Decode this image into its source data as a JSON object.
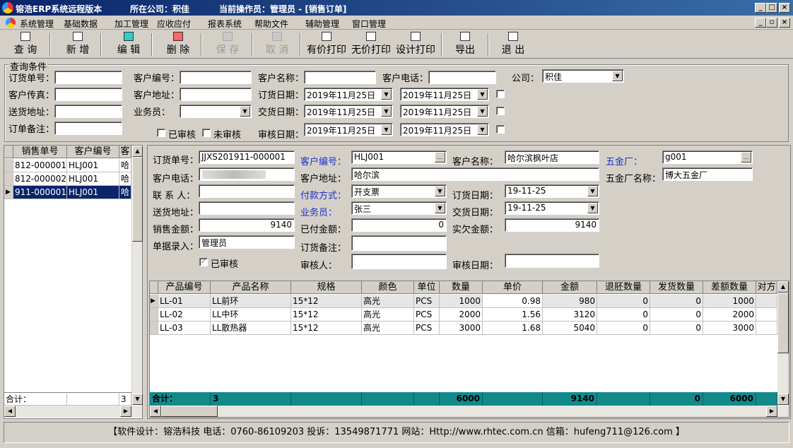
{
  "title": {
    "app": "镕浩ERP系统远程版本",
    "company_label": "所在公司：积佳",
    "operator_label": "当前操作员：管理员 - [销售订单]"
  },
  "menu": [
    "系统管理",
    "基础数据",
    "加工管理",
    "应收应付",
    "报表系统",
    "帮助文件",
    "辅助管理",
    "窗口管理"
  ],
  "toolbar": {
    "query": "查 询",
    "new": "新 增",
    "edit": "编 辑",
    "delete": "删 除",
    "save": "保 存",
    "cancel": "取 消",
    "print_price": "有价打印",
    "print_noprice": "无价打印",
    "print_design": "设计打印",
    "export": "导出",
    "exit": "退 出"
  },
  "query": {
    "legend": "查询条件",
    "order_no": "订货单号：",
    "cust_code": "客户编号：",
    "cust_name": "客户名称：",
    "cust_phone": "客户电话：",
    "company": "公司：",
    "company_value": "积佳",
    "cust_fax": "客户传真：",
    "cust_addr": "客户地址：",
    "order_date": "订货日期：",
    "ship_addr": "送货地址：",
    "salesman": "业务员：",
    "deliver_date": "交货日期：",
    "remark": "订单备注：",
    "approved": "已审核",
    "unapproved": "未审核",
    "audit_date": "审核日期：",
    "date_value": "2019年11月25日"
  },
  "left_grid": {
    "headers": [
      "销售单号",
      "客户编号",
      "客"
    ],
    "rows": [
      [
        "812-000001",
        "HLJ001",
        "哈"
      ],
      [
        "812-000002",
        "HLJ001",
        "哈"
      ],
      [
        "911-000001",
        "HLJ001",
        "哈"
      ]
    ],
    "total_label": "合计：",
    "total_value": "3"
  },
  "detail": {
    "order_no_label": "订货单号：",
    "order_no": "JJXS201911-000001",
    "cust_code_label": "客户编号：",
    "cust_code": "HLJ001",
    "cust_name_label": "客户名称：",
    "cust_name": "哈尔滨枫叶店",
    "hardware_label": "五金厂：",
    "hardware": "g001",
    "phone_label": "客户电话：",
    "addr_label": "客户地址：",
    "addr": "哈尔滨",
    "hardware_name_label": "五金厂名称：",
    "hardware_name": "博大五金厂",
    "contact_label": "联 系 人：",
    "pay_label": "付款方式：",
    "pay": "开支票",
    "order_date_label": "订货日期：",
    "order_date": "19-11-25",
    "ship_label": "送货地址：",
    "salesman_label": "业务员：",
    "salesman": "张三",
    "deliver_label": "交货日期：",
    "deliver": "19-11-25",
    "sales_amt_label": "销售金额：",
    "sales_amt": "9140",
    "paid_label": "已付金额：",
    "paid": "0",
    "owed_label": "实欠金额：",
    "owed": "9140",
    "entry_label": "单据录入：",
    "entry": "管理员",
    "remark_label": "订货备注：",
    "approved_label": "已审核",
    "auditor_label": "审核人：",
    "audit_date_label": "审核日期："
  },
  "product_grid": {
    "headers": [
      "产品编号",
      "产品名称",
      "规格",
      "颜色",
      "单位",
      "数量",
      "单价",
      "金额",
      "退胚数量",
      "发货数量",
      "差额数量",
      "对方"
    ],
    "rows": [
      [
        "LL-01",
        "LL前环",
        "15*12",
        "高光",
        "PCS",
        "1000",
        "0.98",
        "980",
        "0",
        "0",
        "1000"
      ],
      [
        "LL-02",
        "LL中环",
        "15*12",
        "高光",
        "PCS",
        "2000",
        "1.56",
        "3120",
        "0",
        "0",
        "2000"
      ],
      [
        "LL-03",
        "LL散热器",
        "15*12",
        "高光",
        "PCS",
        "3000",
        "1.68",
        "5040",
        "0",
        "0",
        "3000"
      ]
    ],
    "total_label": "合计：",
    "total_count": "3",
    "total_qty": "6000",
    "total_amt": "9140",
    "total_ship": "0",
    "total_diff": "6000"
  },
  "status": "【软件设计：镕浩科技 电话：0760-86109203  投诉：13549871771 网站：Http://www.rhtec.com.cn 信箱：hufeng711@126.com 】"
}
